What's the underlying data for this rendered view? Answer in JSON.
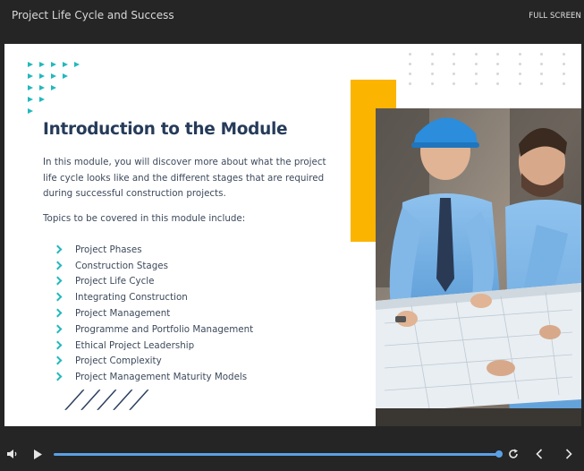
{
  "window": {
    "title": "Project Life Cycle and Success",
    "fullscreen_label": "FULL SCREEN"
  },
  "slide": {
    "heading": "Introduction to the Module",
    "intro": "In this module, you will discover more about what the project life cycle looks like and the different stages that are required during successful construction projects.",
    "topics_intro": "Topics to be covered in this module include:",
    "topics": [
      "Project Phases",
      "Construction Stages",
      "Project Life Cycle",
      "Integrating Construction",
      "Project Management",
      "Programme and Portfolio Management",
      "Ethical Project Leadership",
      "Project Complexity",
      "Project Management Maturity Models"
    ],
    "colors": {
      "accent_teal": "#22b8bd",
      "accent_orange": "#fbb400",
      "heading_navy": "#263b5a"
    }
  },
  "player": {
    "progress": 1.0,
    "icons": [
      "volume-icon",
      "play-icon",
      "replay-icon",
      "previous-icon",
      "next-icon"
    ],
    "accent": "#5aa0e6"
  }
}
